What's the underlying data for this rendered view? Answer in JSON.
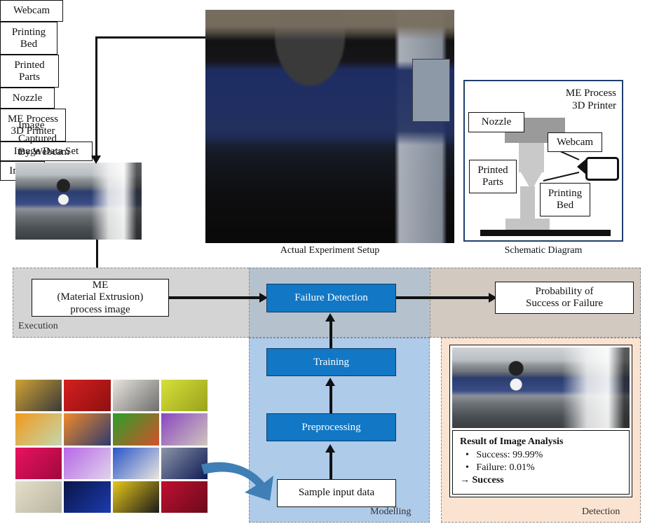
{
  "figure": {
    "captions": {
      "setup": "Actual Experiment Setup",
      "schematic": "Schematic Diagram"
    }
  },
  "top_left": {
    "capture_label": "Image\nCaptured\nBy Webcam",
    "capture_label_lines": [
      "Image",
      "Captured",
      "By Webcam"
    ],
    "photo_name": "webcam-captured-printer-photo"
  },
  "setup_photo": {
    "labels": {
      "webcam": "Webcam",
      "printing_bed": "Printing\nBed",
      "printing_bed_lines": [
        "Printing",
        "Bed"
      ],
      "printed_parts": "Printed\nParts",
      "printed_parts_lines": [
        "Printed",
        "Parts"
      ],
      "nozzle": "Nozzle",
      "printer": "ME Process\n3D Printer",
      "printer_lines": [
        "ME Process",
        "3D Printer"
      ]
    }
  },
  "schematic": {
    "title_lines": [
      "ME Process",
      "3D Printer"
    ],
    "labels": {
      "nozzle": "Nozzle",
      "webcam": "Webcam",
      "printed_parts_lines": [
        "Printed",
        "Parts"
      ],
      "printing_bed_lines": [
        "Printing",
        "Bed"
      ]
    }
  },
  "bands": {
    "execution": {
      "label": "Execution",
      "color_left": "#d4d4d4",
      "color_mid": "#b5c2ce",
      "color_right": "#d2c9c1"
    },
    "modelling": {
      "label": "Modelling",
      "color": "#aecbea"
    },
    "detection": {
      "label": "Detection",
      "color": "#fbe3d2"
    }
  },
  "pipeline": {
    "me_image_lines": [
      "ME",
      "(Material Extrusion)",
      "process image"
    ],
    "failure_detection": "Failure Detection",
    "probability_lines": [
      "Probability of",
      "Success or Failure"
    ],
    "training": "Training",
    "preprocessing": "Preprocessing",
    "sample_input": "Sample input data",
    "box_color": "#1277c4"
  },
  "dataset": {
    "label": "Image  Data Set",
    "tiles": [
      {
        "name": "tile-1",
        "c1": "#cfa233",
        "c2": "#3a3a3a"
      },
      {
        "name": "tile-2",
        "c1": "#d51f1f",
        "c2": "#8e1010"
      },
      {
        "name": "tile-3",
        "c1": "#e8e4dd",
        "c2": "#6e6e6e"
      },
      {
        "name": "tile-4",
        "c1": "#d7e03a",
        "c2": "#9aa21c"
      },
      {
        "name": "tile-5",
        "c1": "#f09a1a",
        "c2": "#c3d6b0"
      },
      {
        "name": "tile-6",
        "c1": "#ef8a2a",
        "c2": "#2d3a6e"
      },
      {
        "name": "tile-7",
        "c1": "#2aa02a",
        "c2": "#d4502a"
      },
      {
        "name": "tile-8",
        "c1": "#8a46c0",
        "c2": "#cfc6bd"
      },
      {
        "name": "tile-9",
        "c1": "#e8135e",
        "c2": "#a1083f"
      },
      {
        "name": "tile-10",
        "c1": "#b866e8",
        "c2": "#e0d4ea"
      },
      {
        "name": "tile-11",
        "c1": "#2a55c8",
        "c2": "#e9e6de"
      },
      {
        "name": "tile-12",
        "c1": "#8d94a8",
        "c2": "#0d1b55"
      },
      {
        "name": "tile-13",
        "c1": "#e3dfc8",
        "c2": "#b8b4a2"
      },
      {
        "name": "tile-14",
        "c1": "#0b1546",
        "c2": "#1b3bb0"
      },
      {
        "name": "tile-15",
        "c1": "#e8c81a",
        "c2": "#1a1a1a"
      },
      {
        "name": "tile-16",
        "c1": "#c01030",
        "c2": "#6b0a1c"
      }
    ],
    "arrow_color": "#3f7fb5"
  },
  "detection_panel": {
    "image_label": "Image",
    "result_title": "Result of Image Analysis",
    "bullets": [
      "Success: 99.99%",
      "Failure: 0.01%"
    ],
    "conclusion": "→ Success",
    "bullet_glyph": "•"
  }
}
